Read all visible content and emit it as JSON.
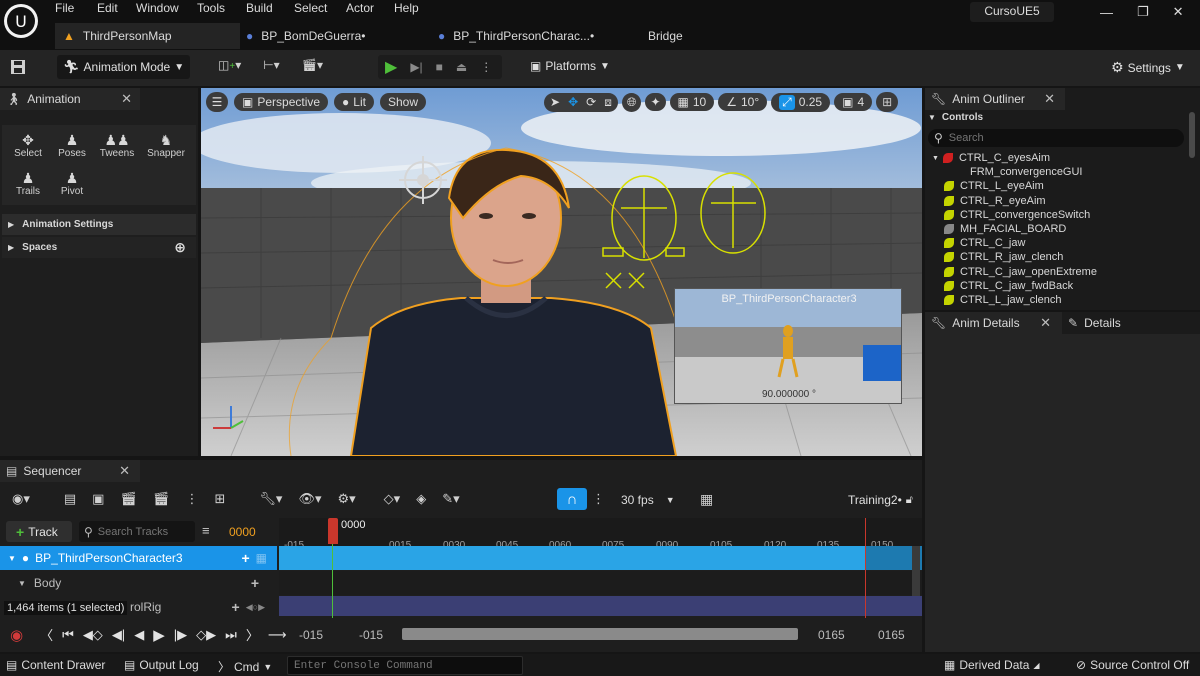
{
  "menu": {
    "items": [
      "File",
      "Edit",
      "Window",
      "Tools",
      "Build",
      "Select",
      "Actor",
      "Help"
    ],
    "project": "CursoUE5"
  },
  "tabs": [
    {
      "label": "ThirdPersonMap"
    },
    {
      "label": "BP_BomDeGuerra•"
    },
    {
      "label": "BP_ThirdPersonCharac...•"
    },
    {
      "label": "Bridge"
    }
  ],
  "toolbar": {
    "mode": "Animation Mode",
    "platforms": "Platforms",
    "settings": "Settings"
  },
  "animation_panel": {
    "title": "Animation",
    "tools": [
      "Select",
      "Poses",
      "Tweens",
      "Snapper",
      "Trails",
      "Pivot"
    ],
    "sections": [
      "Animation Settings",
      "Spaces"
    ]
  },
  "viewport": {
    "perspective": "Perspective",
    "lit": "Lit",
    "show": "Show",
    "grid_value": "10",
    "angle_value": "10°",
    "scale_value": "0.25",
    "camera_speed": "4",
    "pip_title": "BP_ThirdPersonCharacter3",
    "pip_readout": "90.000000 °"
  },
  "outliner": {
    "title": "Anim Outliner",
    "section": "Controls",
    "search_placeholder": "Search",
    "items": [
      "CTRL_C_eyesAim",
      "FRM_convergenceGUI",
      "CTRL_L_eyeAim",
      "CTRL_R_eyeAim",
      "CTRL_convergenceSwitch",
      "MH_FACIAL_BOARD",
      "CTRL_C_jaw",
      "CTRL_R_jaw_clench",
      "CTRL_C_jaw_openExtreme",
      "CTRL_C_jaw_fwdBack",
      "CTRL_L_jaw_clench"
    ]
  },
  "details": {
    "anim_details": "Anim Details",
    "details": "Details"
  },
  "sequencer": {
    "title": "Sequencer",
    "fps": "30 fps",
    "sequence_name": "Training2•",
    "track_button": "Track",
    "search_placeholder": "Search Tracks",
    "current_frame": "0000",
    "playhead_label": "0000",
    "ticks": [
      "-015",
      "0015",
      "0030",
      "0045",
      "0060",
      "0075",
      "0090",
      "0105",
      "0120",
      "0135",
      "0150"
    ],
    "tracks": [
      {
        "label": "BP_ThirdPersonCharacter3"
      },
      {
        "label": "Body"
      },
      {
        "label": "rolRig"
      }
    ],
    "items_status": "1,464 items (1 selected)",
    "range_start_a": "-015",
    "range_start_b": "-015",
    "range_end_a": "0165",
    "range_end_b": "0165"
  },
  "statusbar": {
    "content_drawer": "Content Drawer",
    "output_log": "Output Log",
    "cmd": "Cmd",
    "console_placeholder": "Enter Console Command",
    "derived_data": "Derived Data",
    "source_control": "Source Control Off"
  },
  "colors": {
    "accent_blue": "#1a94e8",
    "track_blue": "#2aa4e6",
    "play_green": "#4fbf3a",
    "selection_orange": "#f0a020",
    "bg": "#151515"
  }
}
